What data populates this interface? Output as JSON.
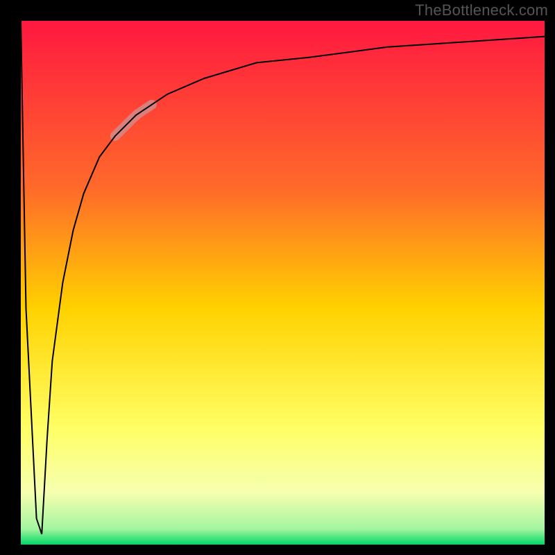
{
  "watermark": "TheBottleneck.com",
  "chart_data": {
    "type": "line",
    "title": "",
    "xlabel": "",
    "ylabel": "",
    "xlim": [
      0,
      100
    ],
    "ylim": [
      0,
      100
    ],
    "grid": false,
    "legend": false,
    "background_gradient": {
      "top_color": "#ff1840",
      "mid_color": "#ffe900",
      "bottom_color": "#00d966",
      "stops": [
        {
          "offset": 0.0,
          "color": "#ff1840"
        },
        {
          "offset": 0.32,
          "color": "#ff6a2a"
        },
        {
          "offset": 0.55,
          "color": "#ffd200"
        },
        {
          "offset": 0.78,
          "color": "#ffff66"
        },
        {
          "offset": 0.9,
          "color": "#f6ffb0"
        },
        {
          "offset": 0.97,
          "color": "#a4f5a0"
        },
        {
          "offset": 1.0,
          "color": "#00d966"
        }
      ]
    },
    "series": [
      {
        "name": "bottleneck-curve",
        "stroke": "#000000",
        "stroke_width": 2,
        "x": [
          0,
          1,
          3,
          4,
          5,
          6,
          8,
          10,
          12,
          15,
          18,
          22,
          28,
          35,
          45,
          55,
          70,
          85,
          100
        ],
        "values": [
          100,
          45,
          5,
          2,
          20,
          35,
          50,
          60,
          67,
          74,
          78,
          82,
          86,
          89,
          92,
          93,
          95,
          96,
          97
        ]
      }
    ],
    "highlight_segment": {
      "series": "bottleneck-curve",
      "x_start": 18,
      "x_end": 25,
      "stroke": "#d48a8a",
      "stroke_width": 14
    }
  }
}
